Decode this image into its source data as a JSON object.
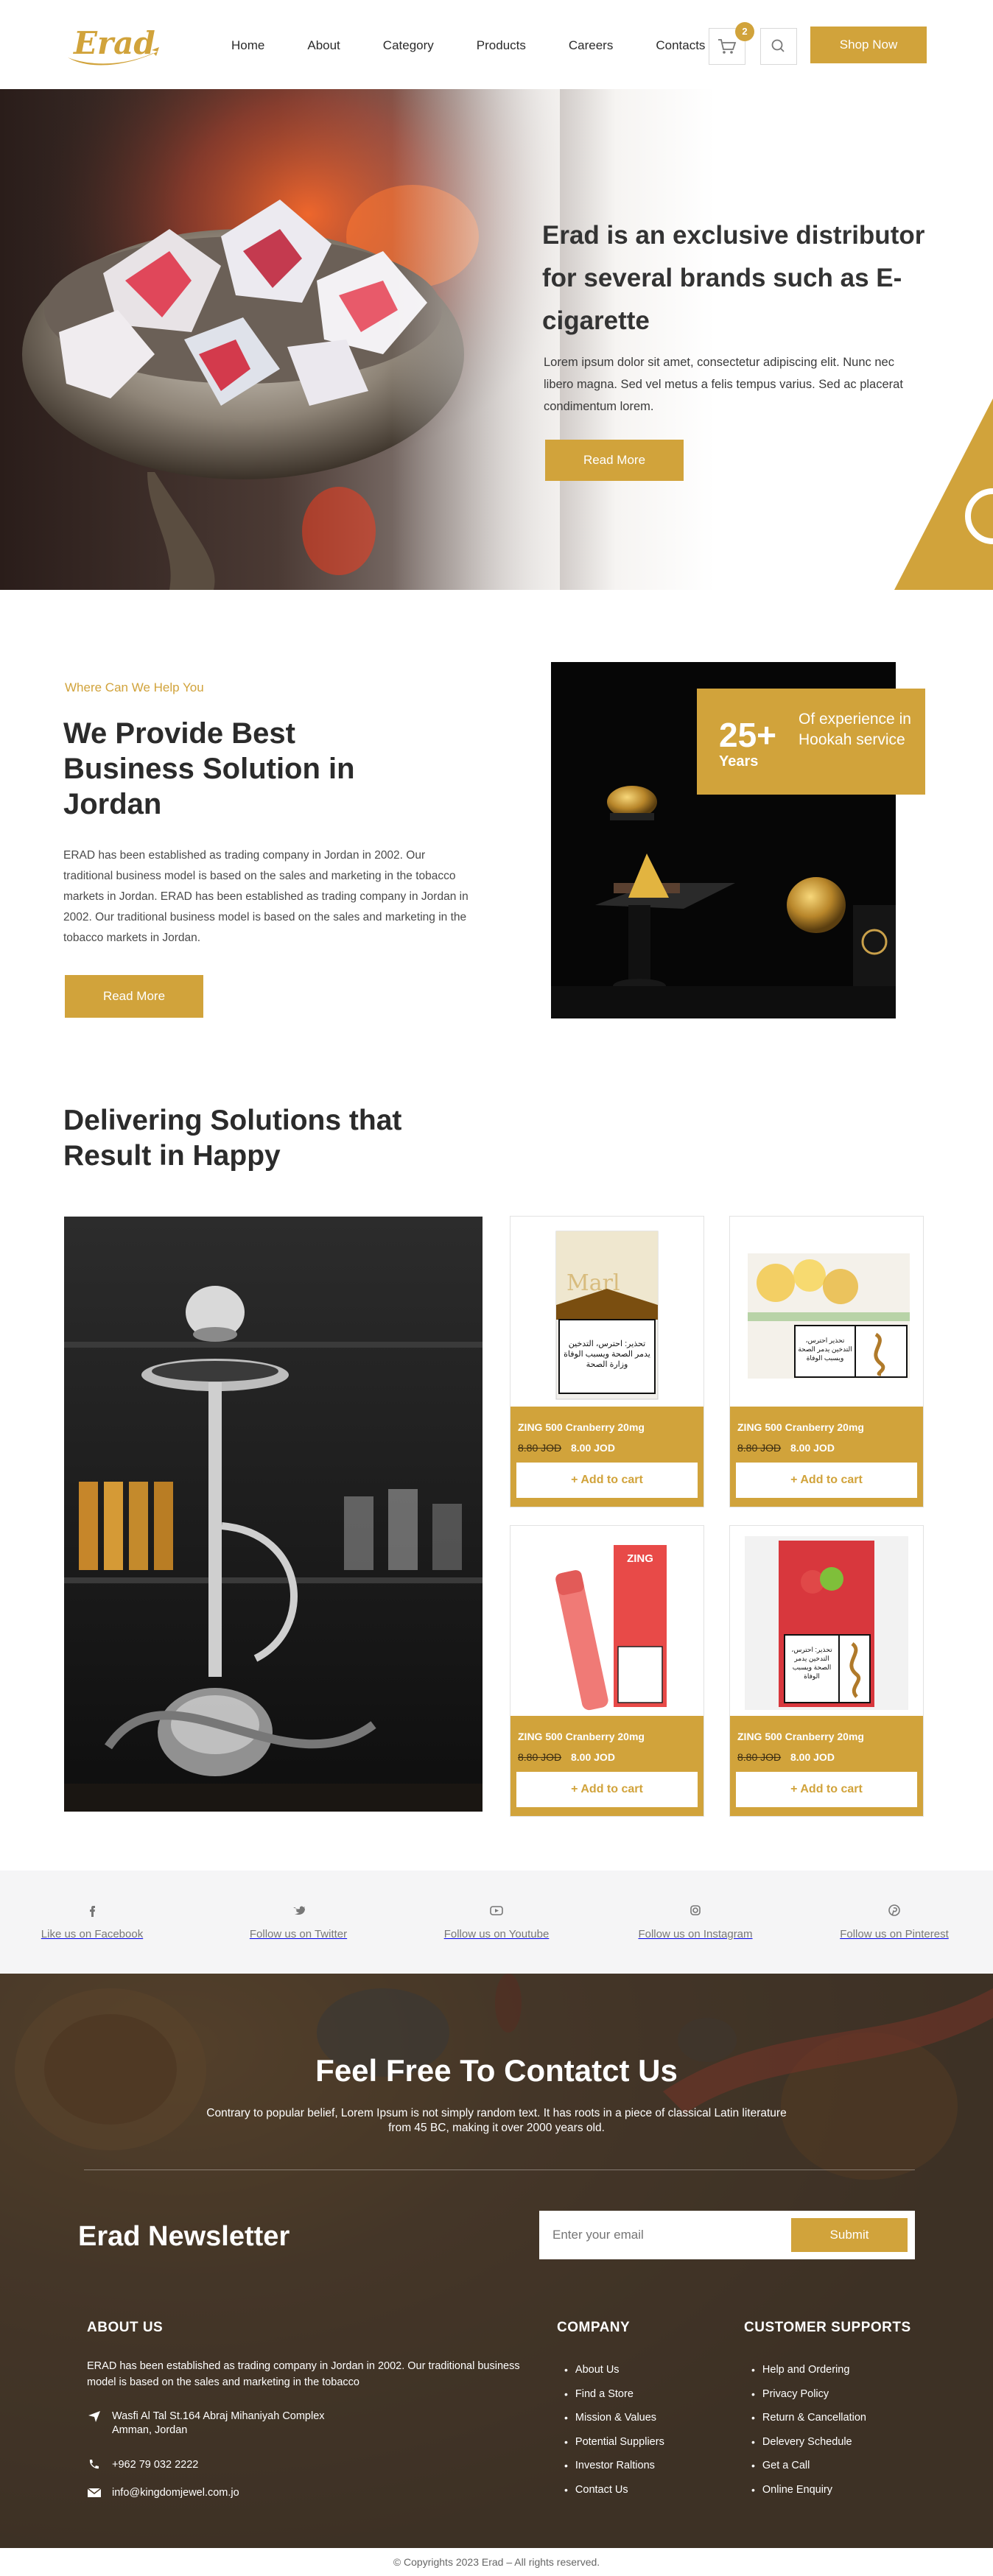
{
  "header": {
    "logo_text": "Erad",
    "nav": [
      "Home",
      "About",
      "Category",
      "Products",
      "Careers",
      "Contacts"
    ],
    "cart_count": "2",
    "shop_label": "Shop Now"
  },
  "hero": {
    "title": "Erad is an exclusive distributor for several brands such as E-cigarette",
    "text": "Lorem ipsum dolor sit amet, consectetur adipiscing elit. Nunc nec libero magna. Sed vel metus a felis tempus varius. Sed ac placerat condimentum lorem.",
    "button": "Read More"
  },
  "about": {
    "eyebrow": "Where Can We Help You",
    "title": "We Provide Best Business Solution in Jordan",
    "text": "ERAD has been established as trading company in Jordan in 2002. Our traditional business model is based on the sales and marketing in the tobacco markets in Jordan. ERAD has been established as trading company in Jordan in 2002. Our traditional business model is based on the sales and marketing in the tobacco markets in Jordan.",
    "button": "Read More",
    "experience": {
      "number": "25+",
      "unit": "Years",
      "label": "Of experience in Hookah service"
    }
  },
  "products": {
    "title": "Delivering Solutions that Result in Happy",
    "items": [
      {
        "name": "ZING 500 Cranberry 20mg",
        "old_price": "8.80 JOD",
        "new_price": "8.00 JOD",
        "cart": "+ Add to cart",
        "warning": "تحذير: احترس، التدخين يدمر الصحة ويسبب الوفاة وزارة الصحة"
      },
      {
        "name": "ZING 500 Cranberry 20mg",
        "old_price": "8.80 JOD",
        "new_price": "8.00 JOD",
        "cart": "+ Add to cart",
        "warning": "تحذير احترس، التدخين يدمر الصحة ويسبب الوفاة"
      },
      {
        "name": "ZING 500 Cranberry 20mg",
        "old_price": "8.80 JOD",
        "new_price": "8.00 JOD",
        "cart": "+ Add to cart",
        "brand": "ZING"
      },
      {
        "name": "ZING 500 Cranberry 20mg",
        "old_price": "8.80 JOD",
        "new_price": "8.00 JOD",
        "cart": "+ Add to cart",
        "warning": "تحذير: احترس، التدخين يدمر الصحة ويسبب الوفاة"
      }
    ]
  },
  "social": [
    {
      "icon": "facebook-icon",
      "label": "Like us on Facebook"
    },
    {
      "icon": "twitter-icon",
      "label": "Follow us on Twitter"
    },
    {
      "icon": "youtube-icon",
      "label": "Follow us on Youtube"
    },
    {
      "icon": "instagram-icon",
      "label": "Follow us on Instagram"
    },
    {
      "icon": "pinterest-icon",
      "label": "Follow us on Pinterest"
    }
  ],
  "contact": {
    "title": "Feel Free To Contatct Us",
    "text": "Contrary to popular belief, Lorem Ipsum is not simply random text. It has roots in a piece of classical Latin literature from 45 BC, making it over 2000 years old."
  },
  "newsletter": {
    "title": "Erad Newsletter",
    "placeholder": "Enter your email",
    "submit": "Submit"
  },
  "footer": {
    "about_heading": "ABOUT US",
    "about_text": "ERAD has been established as trading company in Jordan in 2002. Our traditional business model is based on the sales and marketing in the tobacco",
    "address": "Wasfi Al Tal St.164 Abraj Mihaniyah Complex Amman, Jordan",
    "phone": "+962 79 032 2222",
    "email": "info@kingdomjewel.com.jo",
    "company_heading": "COMPANY",
    "company_links": [
      "About Us",
      "Find a Store",
      "Mission & Values",
      "Potential Suppliers",
      "Investor Raltions",
      "Contact Us"
    ],
    "support_heading": "CUSTOMER SUPPORTS",
    "support_links": [
      "Help and Ordering",
      "Privacy Policy",
      "Return & Cancellation",
      "Delevery Schedule",
      "Get a Call",
      "Online Enquiry"
    ],
    "copyright": "© Copyrights 2023 Erad – All rights reserved."
  },
  "colors": {
    "accent": "#d1a33b",
    "footer_bg": "#4a3a2a",
    "social_bg": "#f5f5f6"
  }
}
